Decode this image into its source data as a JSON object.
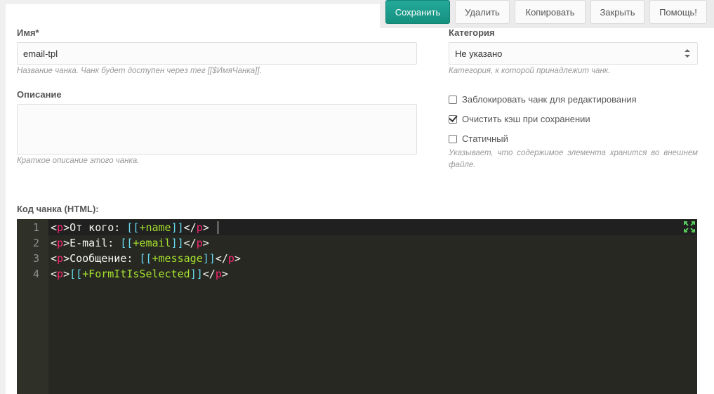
{
  "toolbar": {
    "save": "Сохранить",
    "delete": "Удалить",
    "copy": "Копировать",
    "close": "Закрыть",
    "help": "Помощь!"
  },
  "form": {
    "name_label": "Имя*",
    "name_value": "email-tpl",
    "name_hint": "Название чанка. Чанк будет доступен через тег [[$ИмяЧанка]].",
    "description_label": "Описание",
    "description_value": "",
    "description_hint": "Краткое описание этого чанка.",
    "category_label": "Категория",
    "category_value": "Не указано",
    "category_hint": "Категория, к которой принадлежит чанк.",
    "lock_label": "Заблокировать чанк для редактирования",
    "lock_checked": false,
    "clear_cache_label": "Очистить кэш при сохранении",
    "clear_cache_checked": true,
    "static_label": "Статичный",
    "static_checked": false,
    "static_hint": "Указывает, что содержимое элемента хранится во внешнем файле.",
    "code_label": "Код чанка (HTML):"
  },
  "editor": {
    "line_numbers": [
      "1",
      "2",
      "3",
      "4"
    ],
    "lines": [
      {
        "open_lt": "<",
        "open_tag": "p",
        "open_gt": ">",
        "text": "От кого: ",
        "bk_open": "[[",
        "ph": "+name",
        "bk_close": "]]",
        "close_lt": "</",
        "close_tag": "p",
        "close_gt": ">"
      },
      {
        "open_lt": "<",
        "open_tag": "p",
        "open_gt": ">",
        "text": "E-mail: ",
        "bk_open": "[[",
        "ph": "+email",
        "bk_close": "]]",
        "close_lt": "</",
        "close_tag": "p",
        "close_gt": ">"
      },
      {
        "open_lt": "<",
        "open_tag": "p",
        "open_gt": ">",
        "text": "Сообщение: ",
        "bk_open": "[[",
        "ph": "+message",
        "bk_close": "]]",
        "close_lt": "</",
        "close_tag": "p",
        "close_gt": ">"
      },
      {
        "open_lt": "<",
        "open_tag": "p",
        "open_gt": ">",
        "text": "",
        "bk_open": "[[",
        "ph": "+FormItIsSelected",
        "bk_close": "]]",
        "close_lt": "</",
        "close_tag": "p",
        "close_gt": ">"
      }
    ],
    "fullscreen_icon": "fullscreen-icon"
  },
  "colors": {
    "primary": "#1a9d8c",
    "editor_bg": "#272822",
    "gutter_bg": "#2f3129",
    "tag": "#f92672",
    "bracket": "#66d9ef",
    "placeholder": "#a6e22e",
    "fullscreen": "#58c95a"
  }
}
